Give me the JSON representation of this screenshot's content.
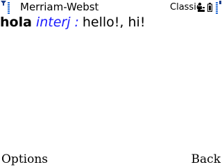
{
  "status_bar": {
    "app_title": "Merriam-Webst",
    "profile": "Classic",
    "signal_icon": "signal-strength-icon",
    "battery_icon": "battery-level-icon",
    "accent_color": "#2a6fd6"
  },
  "entry": {
    "headword": "hola",
    "part_of_speech": "interj",
    "separator": ":",
    "definition": "hello!, hi!"
  },
  "softkeys": {
    "left": "Options",
    "right": "Back"
  }
}
